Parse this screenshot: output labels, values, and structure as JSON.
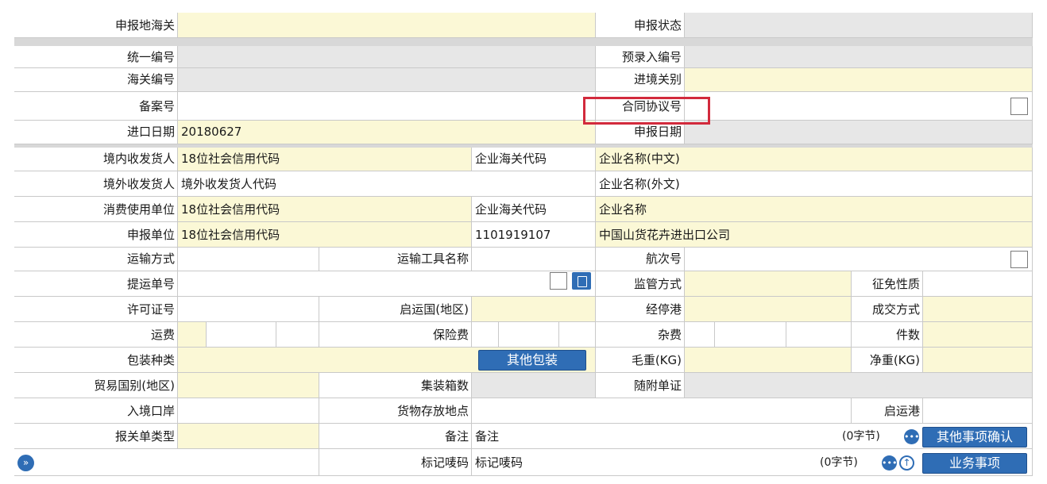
{
  "labels": {
    "customs": "申报地海关",
    "status": "申报状态",
    "unified_no": "统一编号",
    "pre_entry_no": "预录入编号",
    "customs_no": "海关编号",
    "entry_customs": "进境关别",
    "record_no": "备案号",
    "contract_no": "合同协议号",
    "import_date": "进口日期",
    "declare_date": "申报日期",
    "domestic_consignee": "境内收发货人",
    "foreign_consignee": "境外收发货人",
    "consumer_unit": "消费使用单位",
    "declarant": "申报单位",
    "transport_mode": "运输方式",
    "transport_name": "运输工具名称",
    "voyage_no": "航次号",
    "bill_no": "提运单号",
    "supervision_mode": "监管方式",
    "exemption_nature": "征免性质",
    "license_no": "许可证号",
    "origin_country": "启运国(地区)",
    "transit_port": "经停港",
    "deal_mode": "成交方式",
    "freight": "运费",
    "insurance": "保险费",
    "misc_fee": "杂费",
    "pieces": "件数",
    "package_type": "包装种类",
    "gross_weight": "毛重(KG)",
    "net_weight": "净重(KG)",
    "trade_country": "贸易国别(地区)",
    "container_no": "集装箱数",
    "attached_docs": "随附单证",
    "entry_port": "入境口岸",
    "storage_place": "货物存放地点",
    "departure_port": "启运港",
    "declaration_type": "报关单类型",
    "remarks": "备注",
    "marks_no": "标记唛码"
  },
  "values": {
    "import_date": "20180627",
    "domestic_consignee_code": "18位社会信用代码",
    "domestic_consignee_customs_code": "企业海关代码",
    "domestic_consignee_name": "企业名称(中文)",
    "foreign_consignee_code": "境外收发货人代码",
    "foreign_consignee_name": "企业名称(外文)",
    "consumer_unit_code": "18位社会信用代码",
    "consumer_unit_customs_code": "企业海关代码",
    "consumer_unit_name": "企业名称",
    "declarant_code": "18位社会信用代码",
    "declarant_customs_code": "1101919107",
    "declarant_name": "中国山货花卉进出口公司",
    "remarks": "备注",
    "marks_no": "标记唛码",
    "remarks_bytes": "(0字节)",
    "marks_bytes": "(0字节)"
  },
  "buttons": {
    "other_packaging": "其他包装",
    "other_confirm": "其他事项确认",
    "business_items": "业务事项"
  },
  "icons": {
    "expand": "double-chevron-right-icon",
    "more": "ellipsis-icon",
    "upload": "arrow-up-circle-icon",
    "doc": "document-icon"
  },
  "colors": {
    "required_field": "#fbf8d6",
    "readonly_field": "#e7e7e7",
    "accent": "#2f6db5",
    "highlight": "#d22a3c"
  }
}
